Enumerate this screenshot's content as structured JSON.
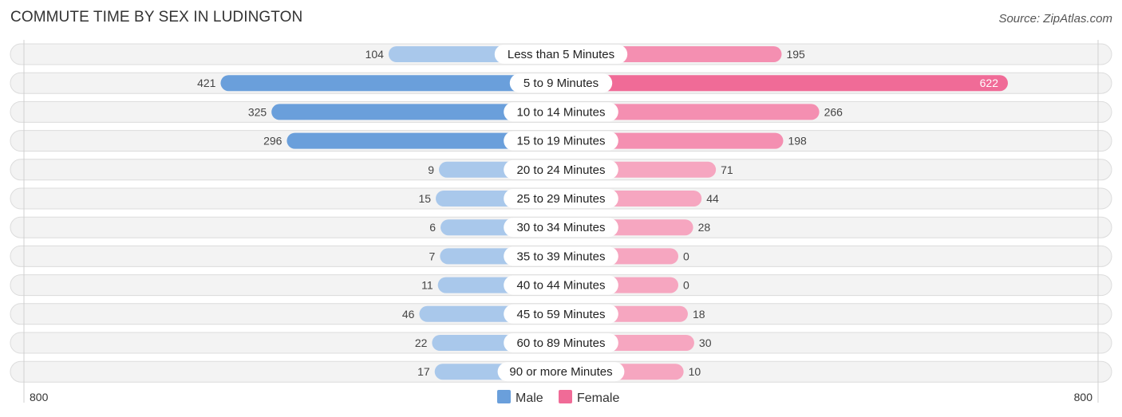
{
  "title": "COMMUTE TIME BY SEX IN LUDINGTON",
  "source": "Source: ZipAtlas.com",
  "colors": {
    "male_strong": "#6a9fdb",
    "male_light": "#a9c8eb",
    "female_strong": "#f06b97",
    "female_light": "#f6a6c0",
    "female_mid": "#f48fb1"
  },
  "chart_data": {
    "type": "bar",
    "orientation": "horizontal-diverging",
    "title": "COMMUTE TIME BY SEX IN LUDINGTON",
    "categories": [
      "Less than 5 Minutes",
      "5 to 9 Minutes",
      "10 to 14 Minutes",
      "15 to 19 Minutes",
      "20 to 24 Minutes",
      "25 to 29 Minutes",
      "30 to 34 Minutes",
      "35 to 39 Minutes",
      "40 to 44 Minutes",
      "45 to 59 Minutes",
      "60 to 89 Minutes",
      "90 or more Minutes"
    ],
    "series": [
      {
        "name": "Male",
        "values": [
          104,
          421,
          325,
          296,
          9,
          15,
          6,
          7,
          11,
          46,
          22,
          17
        ]
      },
      {
        "name": "Female",
        "values": [
          195,
          622,
          266,
          198,
          71,
          44,
          28,
          0,
          0,
          18,
          30,
          10
        ]
      }
    ],
    "axis": {
      "left_tick": "800",
      "right_tick": "800",
      "range": [
        0,
        800
      ]
    },
    "legend": {
      "position": "bottom-center",
      "entries": [
        "Male",
        "Female"
      ]
    },
    "xlabel": "",
    "ylabel": ""
  }
}
